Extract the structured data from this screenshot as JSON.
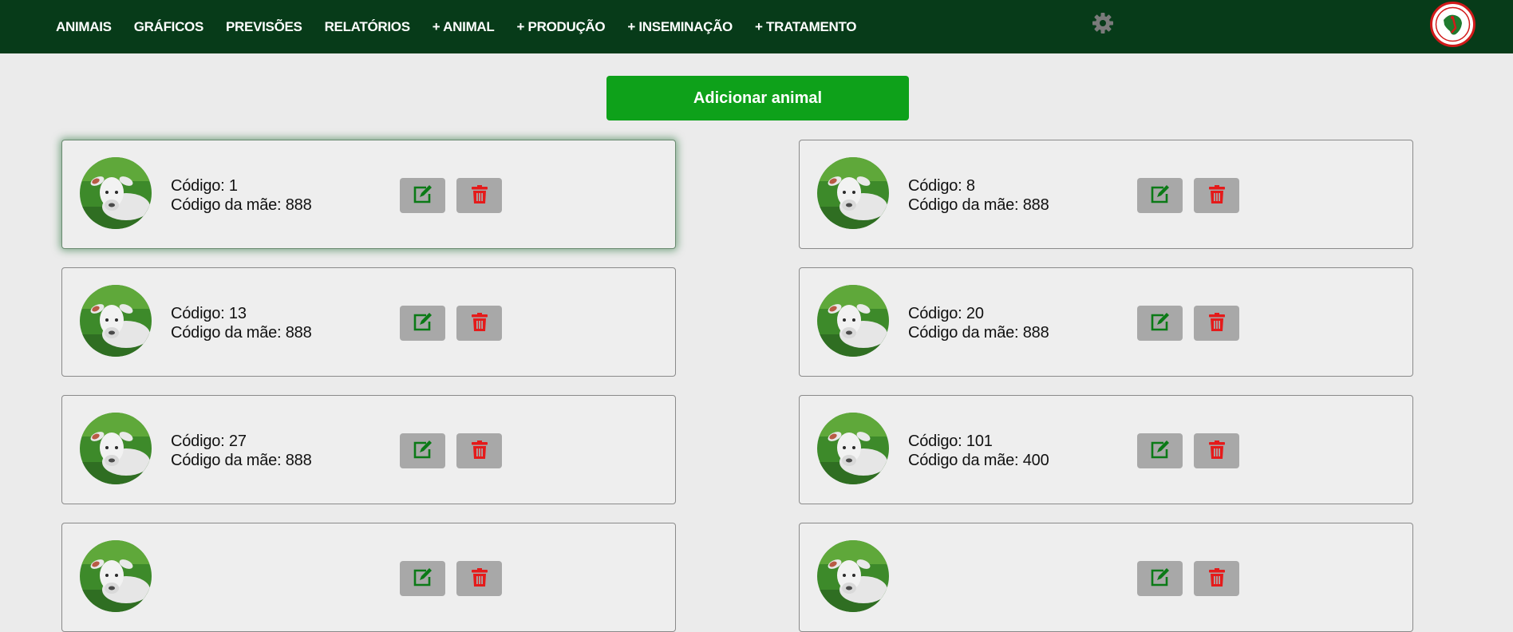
{
  "nav": {
    "items": [
      {
        "label": "ANIMAIS"
      },
      {
        "label": "GRÁFICOS"
      },
      {
        "label": "PREVISÕES"
      },
      {
        "label": "RELATÓRIOS"
      },
      {
        "label": "+ ANIMAL"
      },
      {
        "label": "+ PRODUÇÃO"
      },
      {
        "label": "+ INSEMINAÇÃO"
      },
      {
        "label": "+ TRATAMENTO"
      }
    ],
    "settings_icon": "gear-icon",
    "logo_icon": "logo"
  },
  "add_button": {
    "label": "Adicionar animal"
  },
  "animals": [
    {
      "code_text": "Código: 1",
      "mother_text": "Código da mãe: 888"
    },
    {
      "code_text": "Código: 8",
      "mother_text": "Código da mãe: 888"
    },
    {
      "code_text": "Código: 13",
      "mother_text": "Código da mãe: 888"
    },
    {
      "code_text": "Código: 20",
      "mother_text": "Código da mãe: 888"
    },
    {
      "code_text": "Código: 27",
      "mother_text": "Código da mãe: 888"
    },
    {
      "code_text": "Código: 101",
      "mother_text": "Código da mãe: 400"
    },
    {
      "code_text": "",
      "mother_text": ""
    },
    {
      "code_text": "",
      "mother_text": ""
    }
  ],
  "icons": {
    "edit": "edit-icon",
    "delete": "trash-icon"
  },
  "colors": {
    "topbar": "#073b19",
    "accent_green": "#0ea11a",
    "edit_icon": "#0b7a16",
    "delete_icon": "#e51a1a",
    "action_button_bg": "#a8a8a8"
  }
}
